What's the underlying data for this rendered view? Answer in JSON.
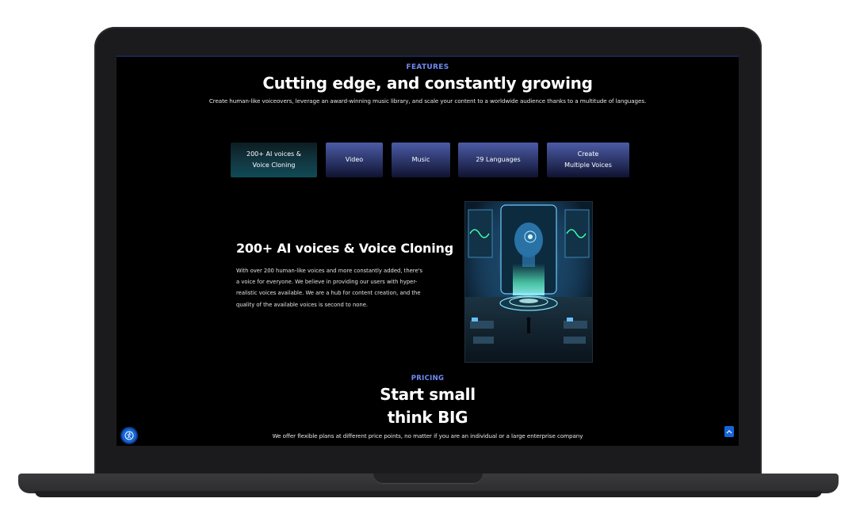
{
  "features": {
    "eyebrow": "FEATURES",
    "title": "Cutting edge, and constantly growing",
    "subtitle": "Create human-like voiceovers, leverage an award-winning music library, and scale your content to a worldwide audience thanks to a multitude of languages.",
    "tabs": [
      {
        "line1": "200+ AI voices &",
        "line2": "Voice Cloning",
        "active": true
      },
      {
        "line1": "Video",
        "line2": "",
        "active": false
      },
      {
        "line1": "Music",
        "line2": "",
        "active": false
      },
      {
        "line1": "29 Languages",
        "line2": "",
        "active": false
      },
      {
        "line1": "Create",
        "line2": "Multiple Voices",
        "active": false
      }
    ],
    "panel": {
      "title": "200+ AI voices & Voice Cloning",
      "body": "With over 200 human-like voices and more constantly added, there's a voice for everyone. We believe in providing our users with hyper-realistic voices available. We are a hub for content creation, and the quality of the available voices is second to none."
    }
  },
  "pricing": {
    "eyebrow": "PRICING",
    "title_line1": "Start small",
    "title_line2": "think BIG",
    "subtitle": "We offer flexible plans at different price points, no matter if you are an individual or a large enterprise company"
  },
  "icons": {
    "accessibility": "accessibility-icon",
    "back_to_top": "chevron-up-icon"
  },
  "colors": {
    "accent": "#6f8cf4",
    "button_blue": "#1565d8",
    "tab_gradient_top": "#4c5ba6",
    "tab_active": "#0f4a55",
    "background": "#000000"
  }
}
